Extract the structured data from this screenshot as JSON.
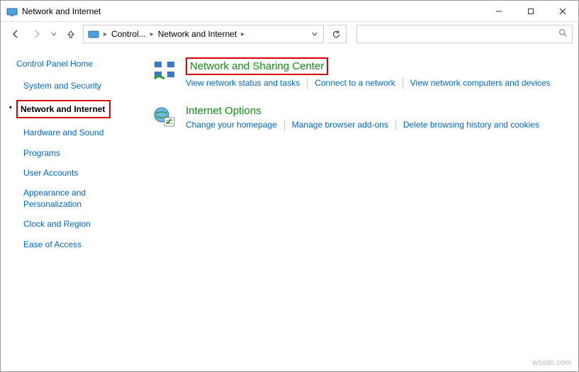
{
  "window": {
    "title": "Network and Internet"
  },
  "breadcrumb": {
    "root_label": "Control...",
    "current_label": "Network and Internet"
  },
  "search": {
    "placeholder": ""
  },
  "sidebar": {
    "home": "Control Panel Home",
    "items": [
      {
        "label": "System and Security"
      },
      {
        "label": "Network and Internet"
      },
      {
        "label": "Hardware and Sound"
      },
      {
        "label": "Programs"
      },
      {
        "label": "User Accounts"
      },
      {
        "label": "Appearance and Personalization"
      },
      {
        "label": "Clock and Region"
      },
      {
        "label": "Ease of Access"
      }
    ]
  },
  "main": {
    "sections": [
      {
        "heading": "Network and Sharing Center",
        "links": [
          "View network status and tasks",
          "Connect to a network",
          "View network computers and devices"
        ]
      },
      {
        "heading": "Internet Options",
        "links": [
          "Change your homepage",
          "Manage browser add-ons",
          "Delete browsing history and cookies"
        ]
      }
    ]
  },
  "watermark": "wsxdn.com"
}
